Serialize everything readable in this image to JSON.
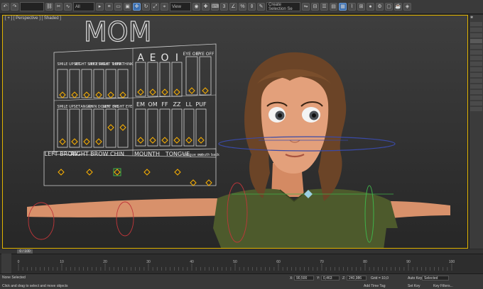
{
  "toolbar": {
    "workspace_value": "",
    "filter_value": "All",
    "view_value": "View",
    "selection_set_value": "Create Selection Se"
  },
  "viewport": {
    "label": "[ + ] [ Perspective ] [ Shaded ]"
  },
  "rig": {
    "title": "MOM",
    "mouth_row1": [
      "SMILE",
      "UPSET",
      "RIGHT SMILE",
      "LEFT SMILE",
      "RIGHT THINK",
      "LEFT THINK"
    ],
    "vowels": [
      "A",
      "E",
      "O",
      "I"
    ],
    "eyes": [
      "EYE OFF",
      "EYE OFF"
    ],
    "mouth_row2": [
      "SMILE",
      "UPSET",
      "ANGRY",
      "CHIN DOWN",
      "LEFT EYE",
      "RIGHT EYE"
    ],
    "visemes": [
      "EM",
      "OM",
      "FF",
      "ZZ",
      "LL",
      "PUF"
    ],
    "bottom": [
      "LEFT BROW",
      "RIGHT BROW",
      "CHIN",
      "MOUNTH",
      "TONGUE",
      "tongue out",
      "mouth back"
    ]
  },
  "timeline": {
    "frame_label": "0 / 100",
    "ticks": [
      "0",
      "10",
      "20",
      "30",
      "40",
      "50",
      "60",
      "70",
      "80",
      "90",
      "100"
    ]
  },
  "status": {
    "selection": "None Selected",
    "prompt": "Click and drag to select and move objects",
    "x_label": "X:",
    "y_label": "Y:",
    "z_label": "Z:",
    "x_value": "90,500",
    "y_value": "0,463",
    "z_value": "240,986",
    "grid": "Grid = 10,0",
    "add_time_tag": "Add Time Tag",
    "auto_key": "Auto Key",
    "set_key": "Set Key",
    "selected": "Selected",
    "key_filters": "Key Filters..."
  },
  "colors": {
    "viewport_border": "#e1b400",
    "rig_diamond": "#ffb300",
    "gizmo_blue": "#3a4aa8",
    "gizmo_red": "#c0363a",
    "gizmo_green": "#3fb24a"
  }
}
